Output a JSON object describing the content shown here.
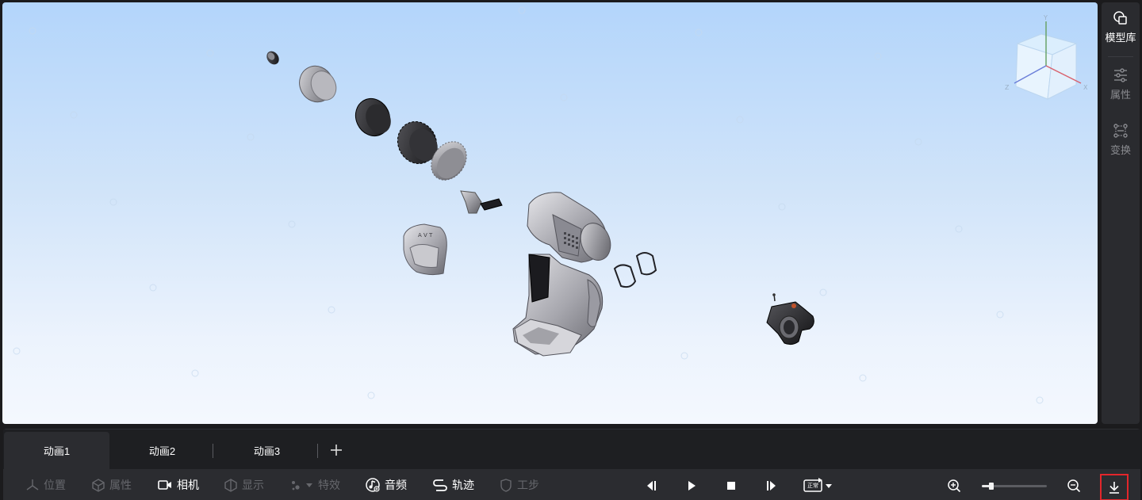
{
  "right_panel": {
    "items": [
      {
        "label": "模型库",
        "icon": "model-library-icon",
        "active": true
      },
      {
        "label": "属性",
        "icon": "properties-sliders-icon",
        "active": false
      },
      {
        "label": "变换",
        "icon": "transform-icon",
        "active": false
      }
    ]
  },
  "view_cube": {
    "axis_y": "Y",
    "axis_x": "X",
    "axis_z": "Z"
  },
  "tabs": {
    "items": [
      {
        "label": "动画1",
        "active": true
      },
      {
        "label": "动画2",
        "active": false
      },
      {
        "label": "动画3",
        "active": false
      }
    ],
    "add_icon": "plus-icon"
  },
  "toolbar": {
    "position": "位置",
    "properties": "属性",
    "camera": "相机",
    "display": "显示",
    "effects": "特效",
    "audio": "音频",
    "trajectory": "轨迹",
    "workstep": "工步",
    "speed_label": "正常",
    "zoom_level": 0.15
  },
  "colors": {
    "background": "#1b1b1d",
    "panel": "#2b2c30",
    "viewport_top": "#b3d5fb",
    "viewport_bottom": "#f4f8fe",
    "highlight": "#e3262b"
  }
}
